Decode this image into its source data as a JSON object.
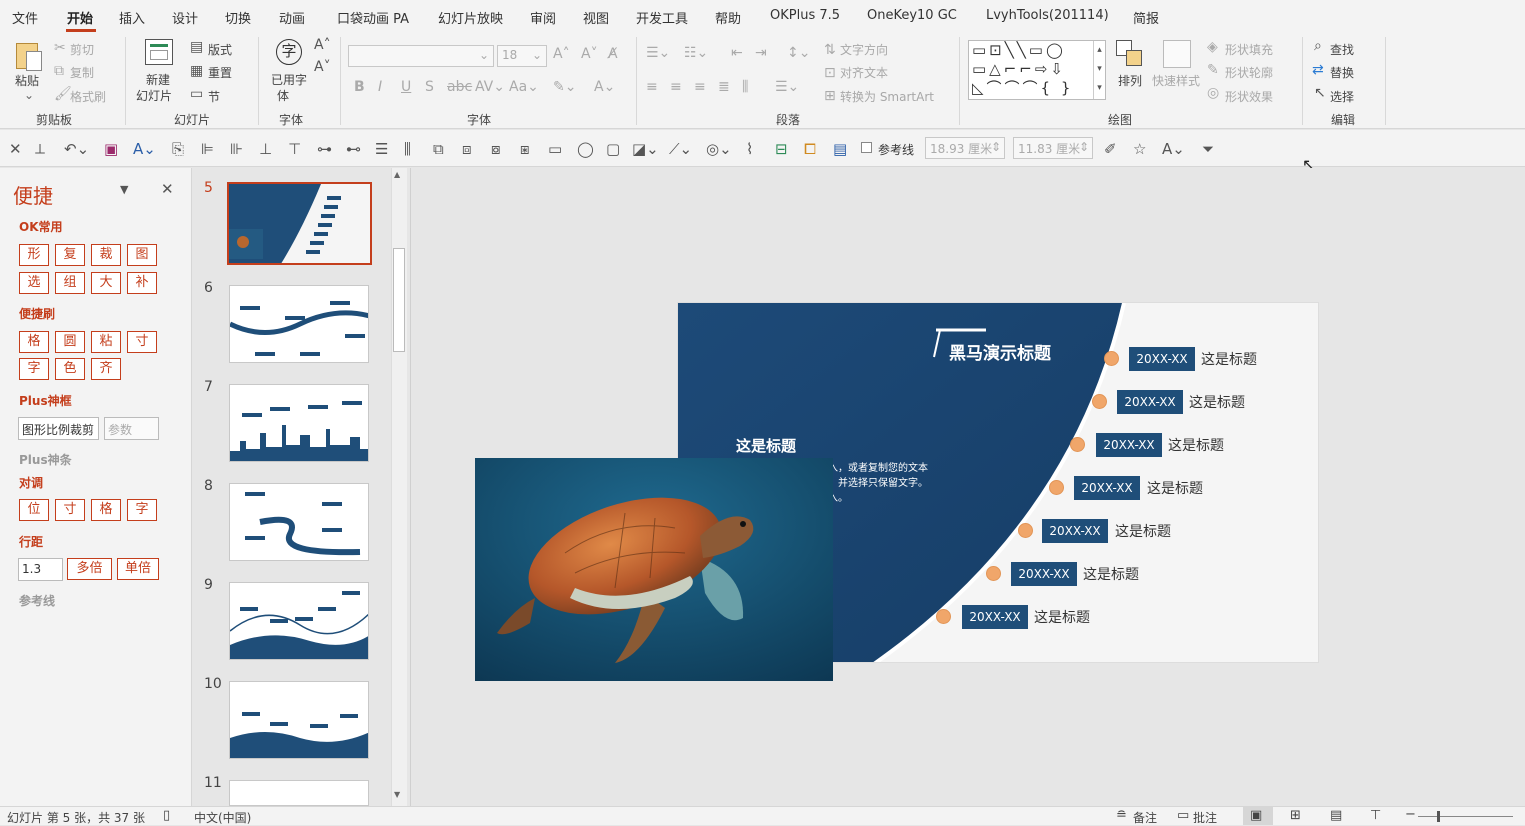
{
  "menu": {
    "items": [
      "文件",
      "开始",
      "插入",
      "设计",
      "切换",
      "动画",
      "口袋动画 PA",
      "幻灯片放映",
      "审阅",
      "视图",
      "开发工具",
      "帮助",
      "OKPlus 7.5",
      "OneKey10 GC",
      "LvyhTools(201114)",
      "简报"
    ],
    "active": "开始"
  },
  "ribbon": {
    "clipboard": {
      "paste": "粘贴",
      "cut": "剪切",
      "copy": "复制",
      "format_painter": "格式刷",
      "label": "剪贴板"
    },
    "slides": {
      "new_slide_line1": "新建",
      "new_slide_line2": "幻灯片",
      "layout": "版式",
      "reset": "重置",
      "section": "节",
      "label": "幻灯片"
    },
    "font_group": {
      "used_font_line1": "已用字",
      "used_font_line2": "体",
      "char_icon": "字",
      "label": "字体"
    },
    "font": {
      "size": "18",
      "label": "字体"
    },
    "paragraph": {
      "text_direction": "文字方向",
      "align_text": "对齐文本",
      "smartart": "转换为 SmartArt",
      "label": "段落"
    },
    "drawing": {
      "arrange": "排列",
      "quick_styles": "快速样式",
      "shape_fill": "形状填充",
      "shape_outline": "形状轮廓",
      "shape_effects": "形状效果",
      "label": "绘图"
    },
    "editing": {
      "find": "查找",
      "replace": "替换",
      "select": "选择",
      "label": "编辑"
    }
  },
  "toolbar": {
    "guides": "参考线",
    "width": "18.93 厘米",
    "height": "11.83 厘米"
  },
  "quick_panel": {
    "title": "便捷",
    "ok_common": "OK常用",
    "row1": [
      "形",
      "复",
      "裁",
      "图"
    ],
    "row2": [
      "选",
      "组",
      "大",
      "补"
    ],
    "quick_brush": "便捷刷",
    "row3": [
      "格",
      "圆",
      "粘",
      "寸"
    ],
    "row4": [
      "字",
      "色",
      "齐"
    ],
    "plus_frame": "Plus神框",
    "crop_input": "图形比例裁剪",
    "param_placeholder": "参数",
    "plus_strip": "Plus神条",
    "align": "对调",
    "row5": [
      "位",
      "寸",
      "格",
      "字"
    ],
    "line_spacing": "行距",
    "spacing_value": "1.3",
    "multi": "多倍",
    "single": "单倍",
    "guides": "参考线"
  },
  "thumbnails": {
    "numbers": [
      "5",
      "6",
      "7",
      "8",
      "9",
      "10",
      "11"
    ],
    "selected": "5"
  },
  "slide": {
    "title": "黑马演示标题",
    "subtitle": "这是标题",
    "body_line1": "入，或者复制您的文本",
    "body_line2": "，并选择只保留文字。",
    "body_line3": "入。",
    "timeline": [
      {
        "date": "20XX-XX",
        "title": "这是标题"
      },
      {
        "date": "20XX-XX",
        "title": "这是标题"
      },
      {
        "date": "20XX-XX",
        "title": "这是标题"
      },
      {
        "date": "20XX-XX",
        "title": "这是标题"
      },
      {
        "date": "20XX-XX",
        "title": "这是标题"
      },
      {
        "date": "20XX-XX",
        "title": "这是标题"
      },
      {
        "date": "20XX-XX",
        "title": "这是标题"
      }
    ],
    "colors": {
      "navy": "#1f4e79",
      "dot": "#f0a66a"
    }
  },
  "status": {
    "slide_info": "幻灯片 第 5 张，共 37 张",
    "language": "中文(中国)",
    "notes": "备注",
    "comments": "批注"
  }
}
